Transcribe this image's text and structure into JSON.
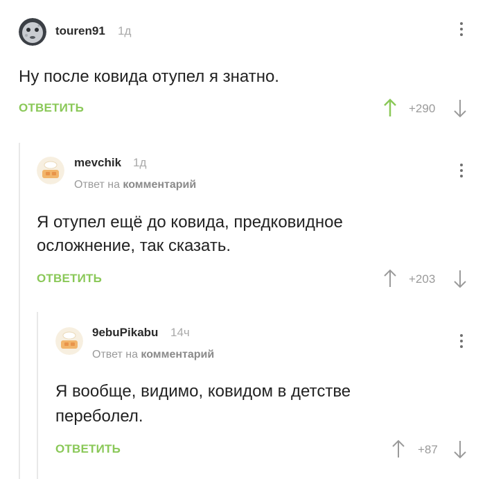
{
  "comments": [
    {
      "username": "touren91",
      "time": "1д",
      "text": "Ну после ковида отупел я знатно.",
      "reply_label": "ОТВЕТИТЬ",
      "rating": "+290",
      "upvoted": true
    },
    {
      "username": "mevchik",
      "time": "1д",
      "reply_prefix": "Ответ на",
      "reply_target": "комментарий",
      "text_line1": "Я отупел ещё до ковида, предковидное",
      "text_line2": "осложнение, так сказать.",
      "reply_label": "ОТВЕТИТЬ",
      "rating": "+203",
      "upvoted": false
    },
    {
      "username": "9ebuPikabu",
      "time": "14ч",
      "reply_prefix": "Ответ на",
      "reply_target": "комментарий",
      "text_line1": "Я вообще, видимо, ковидом в детстве",
      "text_line2": "переболел.",
      "reply_label": "ОТВЕТИТЬ",
      "rating": "+87",
      "upvoted": false
    }
  ],
  "colors": {
    "accent": "#8ac858",
    "muted": "#9a9a9a",
    "thread_line": "#e8e8e8"
  },
  "icons": {
    "upvote": "arrow-up-icon",
    "downvote": "arrow-down-icon",
    "menu": "more-vertical-icon"
  }
}
